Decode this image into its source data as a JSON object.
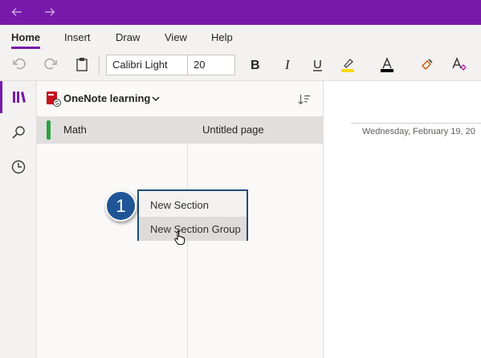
{
  "ribbon": {
    "tabs": [
      {
        "label": "Home",
        "active": true
      },
      {
        "label": "Insert"
      },
      {
        "label": "Draw"
      },
      {
        "label": "View"
      },
      {
        "label": "Help"
      }
    ],
    "font_name": "Calibri Light",
    "font_size": "20"
  },
  "notebook": {
    "title": "OneNote learning"
  },
  "sections": [
    {
      "label": "Math",
      "color": "#2ea043"
    }
  ],
  "pages": [
    {
      "label": "Untitled page"
    }
  ],
  "canvas": {
    "date": "Wednesday, February 19, 20"
  },
  "context_menu": {
    "items": [
      {
        "label": "New Section"
      },
      {
        "label": "New Section Group",
        "hovered": true
      }
    ]
  },
  "callout": {
    "number": "1"
  },
  "colors": {
    "accent": "#7719aa",
    "highlight": "#ffd800",
    "callout": "#1f5596"
  }
}
